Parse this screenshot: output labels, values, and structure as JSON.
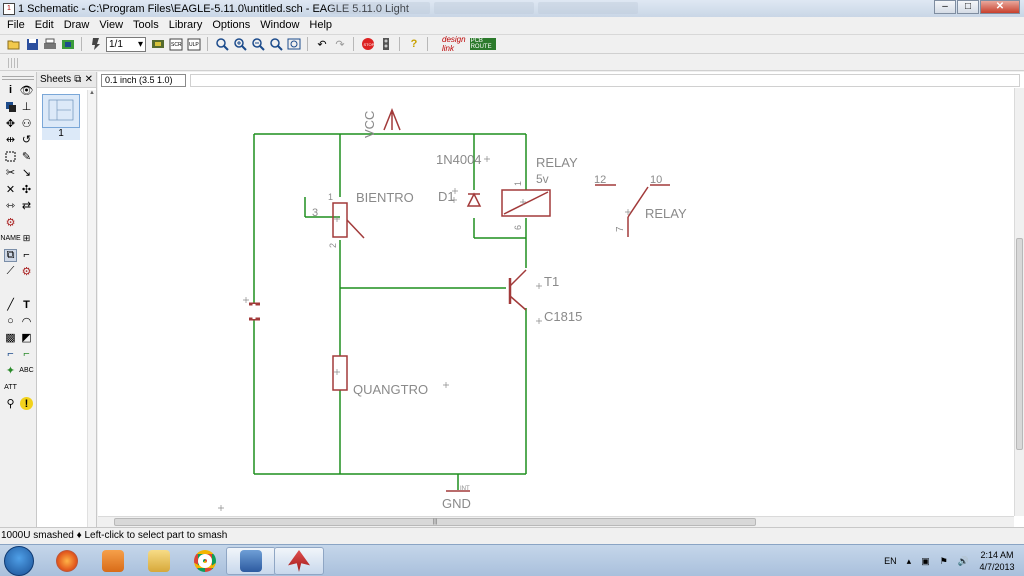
{
  "window": {
    "title": "1 Schematic - C:\\Program Files\\EAGLE-5.11.0\\untitled.sch - EAGLE 5.11.0 Light",
    "app_icon_label": "1",
    "buttons": [
      "minimize",
      "maximize",
      "close"
    ]
  },
  "menu": [
    "File",
    "Edit",
    "Draw",
    "View",
    "Tools",
    "Library",
    "Options",
    "Window",
    "Help"
  ],
  "toolbar": {
    "sheet_value": "1/1",
    "icons": [
      "open-icon",
      "save-icon",
      "print-icon",
      "cam-icon",
      "script-icon",
      "sheet-select",
      "ulp-icon",
      "scr-icon",
      "ulp-run-icon",
      "zoom-fit-icon",
      "zoom-in-icon",
      "zoom-out-icon",
      "zoom-redraw-icon",
      "zoom-select-icon",
      "undo-icon",
      "redo-icon",
      "stop-icon",
      "go-icon",
      "help-icon",
      "design-link-icon",
      "board-icon"
    ],
    "pcb_label": "PCB ROUTE"
  },
  "sheets_panel": {
    "title": "Sheets",
    "sheet_number": "1"
  },
  "canvas": {
    "coordinate_display": "0.1 inch (3.5 1.0)"
  },
  "schematic": {
    "labels": {
      "vcc": "VCC",
      "gnd": "GND",
      "gnd_tag": "INT",
      "diode_part": "1N4004",
      "diode_name": "D1",
      "relay_name": "RELAY",
      "relay_value": "5v",
      "relay_contact_name": "RELAY",
      "pot_name": "BIENTRO",
      "photoresistor_name": "QUANGTRO",
      "transistor_name": "T1",
      "transistor_value": "C1815",
      "pin_12": "12",
      "pin_10": "10",
      "pin_7": "7",
      "pot_pin_1": "1",
      "pot_pin_2": "2",
      "pot_pin_3": "3",
      "relay_pin_1": "1",
      "relay_pin_6": "6"
    },
    "wire_color": "#1f8f1f",
    "part_color": "#a23a3a",
    "text_color": "#8a8a8a"
  },
  "status": {
    "text": "1000U smashed  ♦ Left-click to select part to smash"
  },
  "taskbar": {
    "apps": [
      "firefox",
      "media-player",
      "explorer",
      "chrome",
      "network-monitor",
      "eagle"
    ],
    "language": "EN",
    "time": "2:14 AM",
    "date": "4/7/2013"
  }
}
